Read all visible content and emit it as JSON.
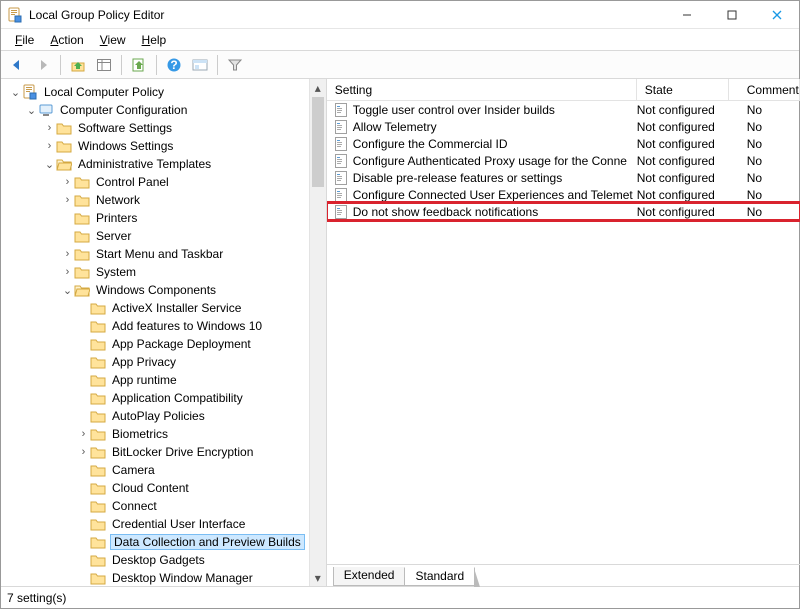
{
  "window": {
    "title": "Local Group Policy Editor"
  },
  "menu": {
    "file": "File",
    "action": "Action",
    "view": "View",
    "help": "Help"
  },
  "tree": {
    "root": "Local Computer Policy",
    "computer_config": "Computer Configuration",
    "software_settings": "Software Settings",
    "windows_settings": "Windows Settings",
    "admin_templates": "Administrative Templates",
    "control_panel": "Control Panel",
    "network": "Network",
    "printers": "Printers",
    "server": "Server",
    "start_menu": "Start Menu and Taskbar",
    "system": "System",
    "win_components": "Windows Components",
    "items": [
      "ActiveX Installer Service",
      "Add features to Windows 10",
      "App Package Deployment",
      "App Privacy",
      "App runtime",
      "Application Compatibility",
      "AutoPlay Policies",
      "Biometrics",
      "BitLocker Drive Encryption",
      "Camera",
      "Cloud Content",
      "Connect",
      "Credential User Interface",
      "Data Collection and Preview Builds",
      "Desktop Gadgets",
      "Desktop Window Manager"
    ],
    "selected_index": 13
  },
  "list": {
    "headers": {
      "setting": "Setting",
      "state": "State",
      "comment": "Comment"
    },
    "rows": [
      {
        "name": "Toggle user control over Insider builds",
        "state": "Not configured",
        "comment": "No",
        "hl": false
      },
      {
        "name": "Allow Telemetry",
        "state": "Not configured",
        "comment": "No",
        "hl": false
      },
      {
        "name": "Configure the Commercial ID",
        "state": "Not configured",
        "comment": "No",
        "hl": false
      },
      {
        "name": "Configure Authenticated Proxy usage for the Conne",
        "state": "Not configured",
        "comment": "No",
        "hl": false
      },
      {
        "name": "Disable pre-release features or settings",
        "state": "Not configured",
        "comment": "No",
        "hl": false
      },
      {
        "name": "Configure Connected User Experiences and Telemet",
        "state": "Not configured",
        "comment": "No",
        "hl": false
      },
      {
        "name": "Do not show feedback notifications",
        "state": "Not configured",
        "comment": "No",
        "hl": true
      }
    ]
  },
  "tabs": {
    "extended": "Extended",
    "standard": "Standard"
  },
  "status": "7 setting(s)"
}
